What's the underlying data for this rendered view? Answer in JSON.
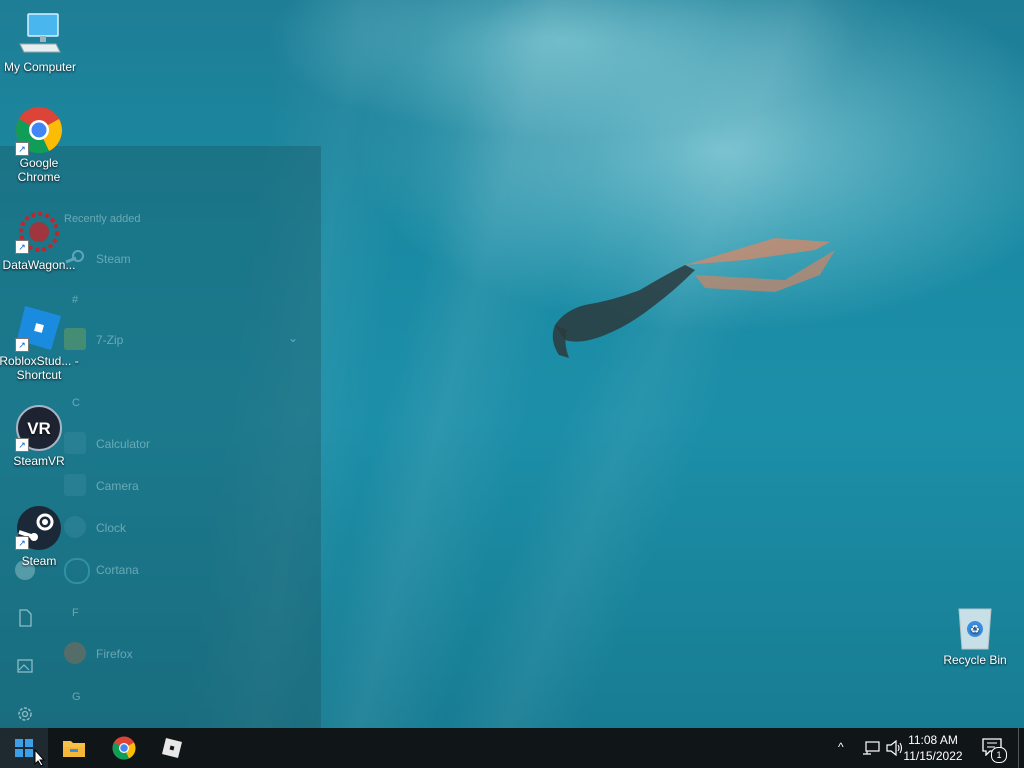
{
  "desktop": {
    "icons": [
      {
        "label": "My Computer",
        "icon": "computer-icon"
      },
      {
        "label": "Google Chrome",
        "icon": "chrome-icon"
      },
      {
        "label": "DataWagon...",
        "icon": "datawagon-icon"
      },
      {
        "label": "RobloxStud... - Shortcut",
        "icon": "roblox-studio-icon"
      },
      {
        "label": "SteamVR",
        "icon": "steamvr-icon"
      },
      {
        "label": "Steam",
        "icon": "steam-icon"
      },
      {
        "label": "Recycle Bin",
        "icon": "recycle-bin-icon"
      }
    ]
  },
  "start_menu": {
    "recently_added_label": "Recently added",
    "items": [
      {
        "section": "",
        "label": "Steam"
      },
      {
        "section": "#",
        "label": "7-Zip"
      },
      {
        "section": "C",
        "label": "Calculator"
      },
      {
        "section": "",
        "label": "Camera"
      },
      {
        "section": "",
        "label": "Clock"
      },
      {
        "section": "",
        "label": "Cortana"
      },
      {
        "section": "F",
        "label": "Firefox"
      },
      {
        "section": "G",
        "label": ""
      }
    ],
    "headers": {
      "hash": "#",
      "c": "C",
      "f": "F",
      "g": "G"
    }
  },
  "taskbar": {
    "pinned": [
      "start-icon",
      "file-explorer-icon",
      "chrome-icon",
      "roblox-icon"
    ],
    "clock_time": "11:08 AM",
    "clock_date": "11/15/2022",
    "notification_count": "1"
  },
  "colors": {
    "taskbar_bg": "#101518",
    "water": "#1c8fa8"
  }
}
